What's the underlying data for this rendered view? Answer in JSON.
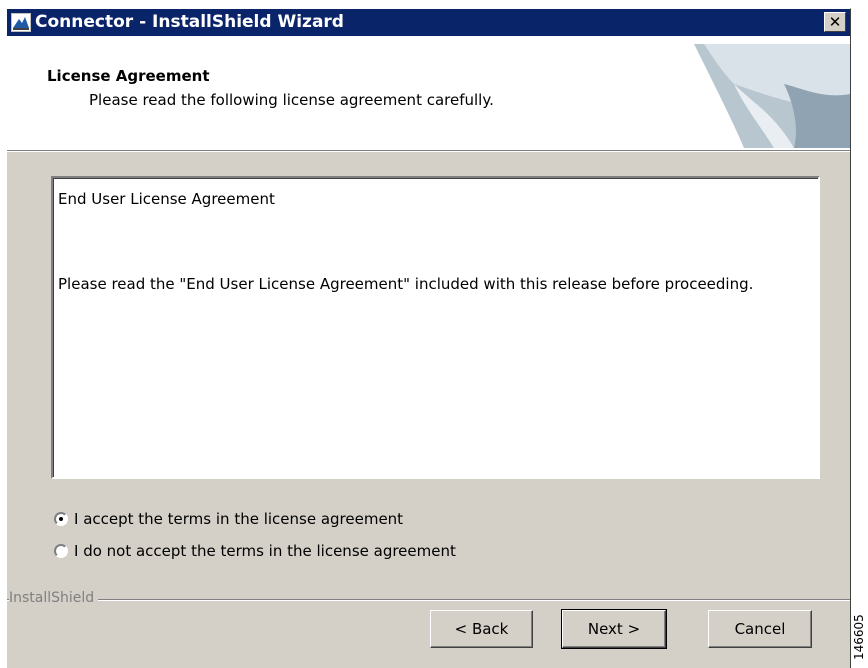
{
  "window": {
    "title": "Connector - InstallShield Wizard",
    "close_glyph": "✕"
  },
  "header": {
    "title": "License Agreement",
    "subtitle": "Please read the following license agreement carefully."
  },
  "license": {
    "heading": "End User License Agreement",
    "body": "Please read the \"End User License Agreement\" included with this release before proceeding."
  },
  "options": [
    {
      "label": "I accept the terms in the license agreement",
      "selected": true
    },
    {
      "label": "I do not accept the terms in the license agreement",
      "selected": false
    }
  ],
  "footer": {
    "brand": "InstallShield",
    "back_label": "< Back",
    "next_label": "Next >",
    "cancel_label": "Cancel"
  },
  "side_mark": "146605",
  "colors": {
    "titlebar": "#0a246a",
    "dialog_face": "#d4d0c8",
    "header_bg": "#ffffff"
  }
}
